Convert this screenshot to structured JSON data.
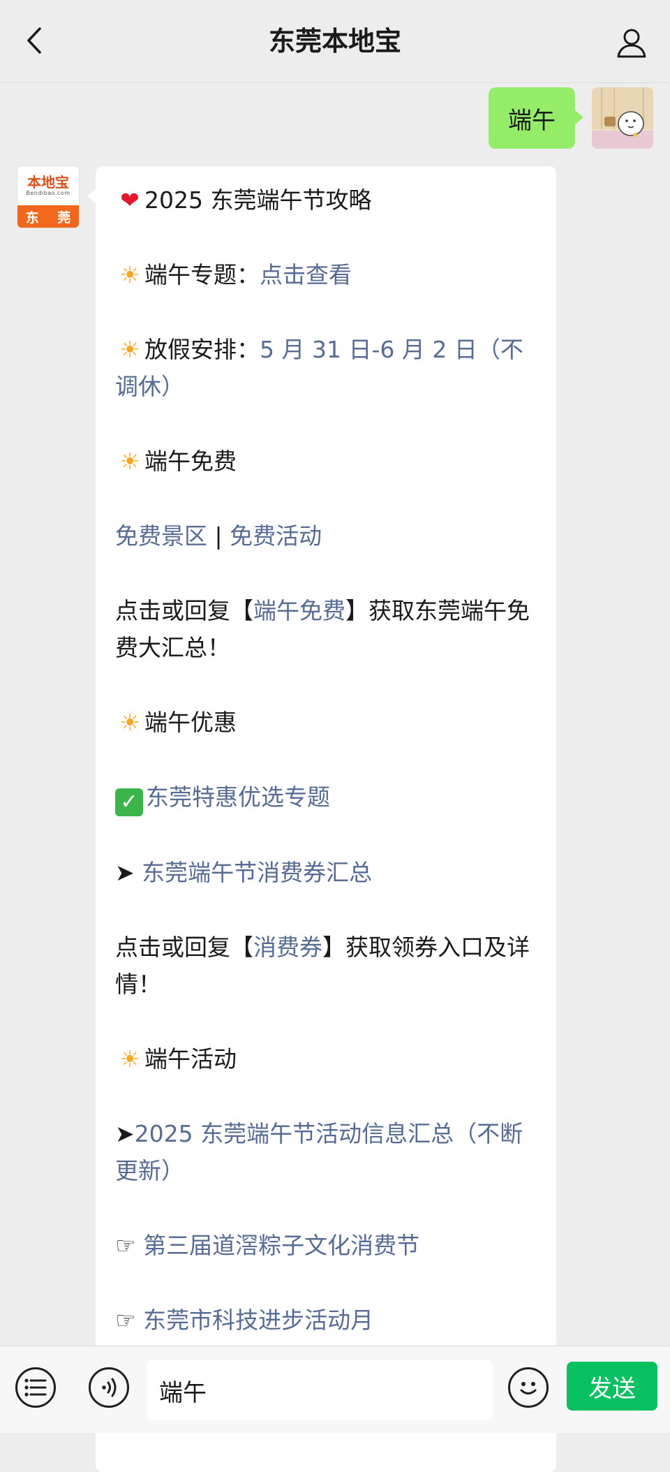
{
  "header": {
    "title": "东莞本地宝"
  },
  "outgoing": {
    "text": "端午"
  },
  "brand_avatar": {
    "logo_text": "本地宝",
    "logo_sub": "Bendibao.com",
    "city": "东 莞"
  },
  "message": {
    "title": "2025 东莞端午节攻略",
    "topic_label": "端午专题：",
    "topic_link": "点击查看",
    "holiday_label": "放假安排：",
    "holiday_link": "5 月 31 日-6 月 2 日（不调休）",
    "free_heading": "端午免费",
    "free_scenic_link": "免费景区",
    "free_sep": " | ",
    "free_activity_link": "免费活动",
    "free_reply_pre": "点击或回复【",
    "free_reply_link": "端午免费",
    "free_reply_post": "】获取东莞端午免费大汇总！",
    "discount_heading": "端午优惠",
    "discount_topic_link": "东莞特惠优选专题",
    "arrow": "➤",
    "coupon_link": "东莞端午节消费券汇总",
    "coupon_reply_pre": "点击或回复【",
    "coupon_reply_link": "消费券",
    "coupon_reply_post": "】获取领券入口及详情！",
    "activity_heading": "端午活动",
    "activity_summary_link": "2025 东莞端午节活动信息汇总（不断更新）",
    "hand": "☞",
    "festival_link": "第三届道滘粽子文化消费节",
    "tech_month_link": "东莞市科技进步活动月"
  },
  "input": {
    "value": "端午"
  },
  "send_label": "发送",
  "icons": {
    "back": "back-icon",
    "profile": "profile-icon",
    "menu": "menu-list-icon",
    "voice": "voice-icon",
    "emoji": "emoji-icon",
    "heart": "heart-icon",
    "sun": "sun-icon",
    "check": "check-icon"
  },
  "colors": {
    "bubble_out": "#95ec69",
    "link": "#576b95",
    "send": "#07c160",
    "brand": "#f1681c"
  }
}
